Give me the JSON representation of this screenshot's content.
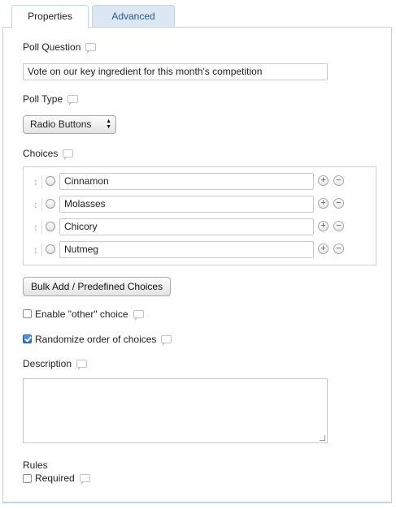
{
  "tabs": [
    {
      "label": "Properties",
      "active": true
    },
    {
      "label": "Advanced",
      "active": false
    }
  ],
  "poll_question": {
    "label": "Poll Question",
    "value": "Vote on our key ingredient for this month's competition"
  },
  "poll_type": {
    "label": "Poll Type",
    "selected": "Radio Buttons"
  },
  "choices": {
    "label": "Choices",
    "items": [
      "Cinnamon",
      "Molasses",
      "Chicory",
      "Nutmeg"
    ]
  },
  "bulk_add_button": "Bulk Add / Predefined Choices",
  "enable_other": {
    "label": "Enable \"other\" choice",
    "checked": false
  },
  "randomize": {
    "label": "Randomize order of choices",
    "checked": true
  },
  "description": {
    "label": "Description",
    "value": ""
  },
  "rules": {
    "label": "Rules",
    "required": {
      "label": "Required",
      "checked": false
    }
  },
  "icons": {
    "help": "speech-bubble-icon",
    "drag": "drag-handle-icon",
    "add": "plus-circle-icon",
    "remove": "minus-circle-icon",
    "select_arrows": "updown-arrows-icon"
  },
  "colors": {
    "tab_active_bg": "#ffffff",
    "tab_inactive_bg": "#dbe8f4",
    "tab_inactive_text": "#2a5a8a",
    "panel_border": "#c4d3e3",
    "checkbox_checked": "#2b6fc4"
  }
}
